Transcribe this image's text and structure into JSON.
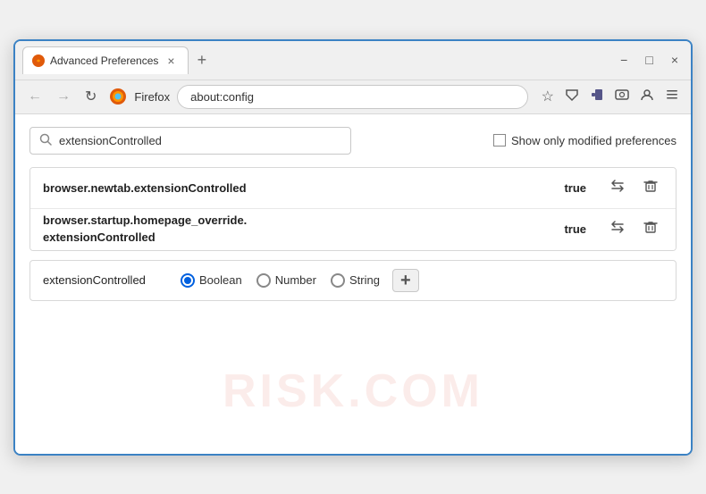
{
  "window": {
    "title": "Advanced Preferences",
    "tab_label": "Advanced Preferences",
    "close_label": "×",
    "minimize_label": "−",
    "maximize_label": "□",
    "new_tab_label": "+"
  },
  "nav": {
    "back_label": "←",
    "forward_label": "→",
    "refresh_label": "↻",
    "firefox_text": "Firefox",
    "address": "about:config",
    "bookmark_icon": "☆",
    "pocket_icon": "⛉",
    "extension_icon": "🧩",
    "screenshot_icon": "📷",
    "profile_icon": "👤",
    "menu_icon": "≡"
  },
  "search": {
    "placeholder": "extensionControlled",
    "value": "extensionControlled",
    "show_modified_label": "Show only modified preferences"
  },
  "preferences": [
    {
      "name": "browser.newtab.extensionControlled",
      "value": "true"
    },
    {
      "name": "browser.startup.homepage_override.\nextensionControlled",
      "name_line1": "browser.startup.homepage_override.",
      "name_line2": "extensionControlled",
      "value": "true",
      "multiline": true
    }
  ],
  "add_preference": {
    "name": "extensionControlled",
    "type_options": [
      "Boolean",
      "Number",
      "String"
    ],
    "selected_type": "Boolean",
    "add_button_label": "+"
  },
  "watermark": "RISK.COM",
  "icons": {
    "search": "🔍",
    "toggle": "⇄",
    "trash": "🗑"
  }
}
